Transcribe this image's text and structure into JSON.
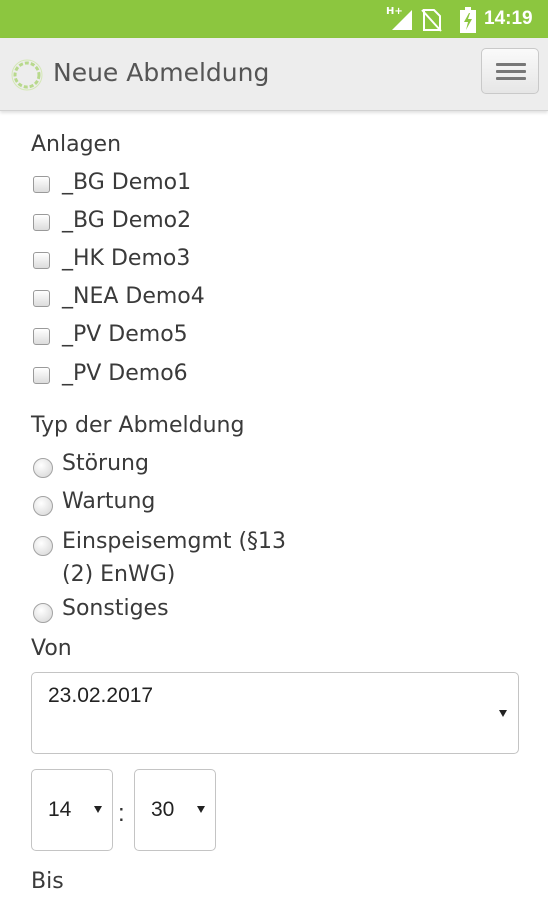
{
  "status_bar": {
    "network": "H+",
    "time": "14:19",
    "icons": [
      "signal-icon",
      "no-sim-icon",
      "battery-charging-icon"
    ]
  },
  "app_bar": {
    "title": "Neue Abmeldung",
    "logo_icon": "sun-ring-logo-icon",
    "menu_icon": "hamburger-menu-icon"
  },
  "colors": {
    "status_bar": "#8cc63f",
    "app_bar": "#ededed",
    "text": "#3a3a3a"
  },
  "anlagen": {
    "label": "Anlagen",
    "items": [
      {
        "label": "_BG Demo1",
        "checked": false
      },
      {
        "label": "_BG Demo2",
        "checked": false
      },
      {
        "label": "_HK Demo3",
        "checked": false
      },
      {
        "label": "_NEA Demo4",
        "checked": false
      },
      {
        "label": "_PV Demo5",
        "checked": false
      },
      {
        "label": "_PV Demo6",
        "checked": false
      }
    ]
  },
  "typ": {
    "label": "Typ der Abmeldung",
    "options": [
      {
        "label": "Störung",
        "selected": false
      },
      {
        "label": "Wartung",
        "selected": false
      },
      {
        "label_line1": "Einspeisemgmt (§13",
        "label_line2": "(2) EnWG)",
        "selected": false
      },
      {
        "label": "Sonstiges",
        "selected": false
      }
    ]
  },
  "von": {
    "label": "Von",
    "date": "23.02.2017",
    "hour": "14",
    "separator": ":",
    "minute": "30"
  },
  "bis": {
    "label": "Bis"
  }
}
